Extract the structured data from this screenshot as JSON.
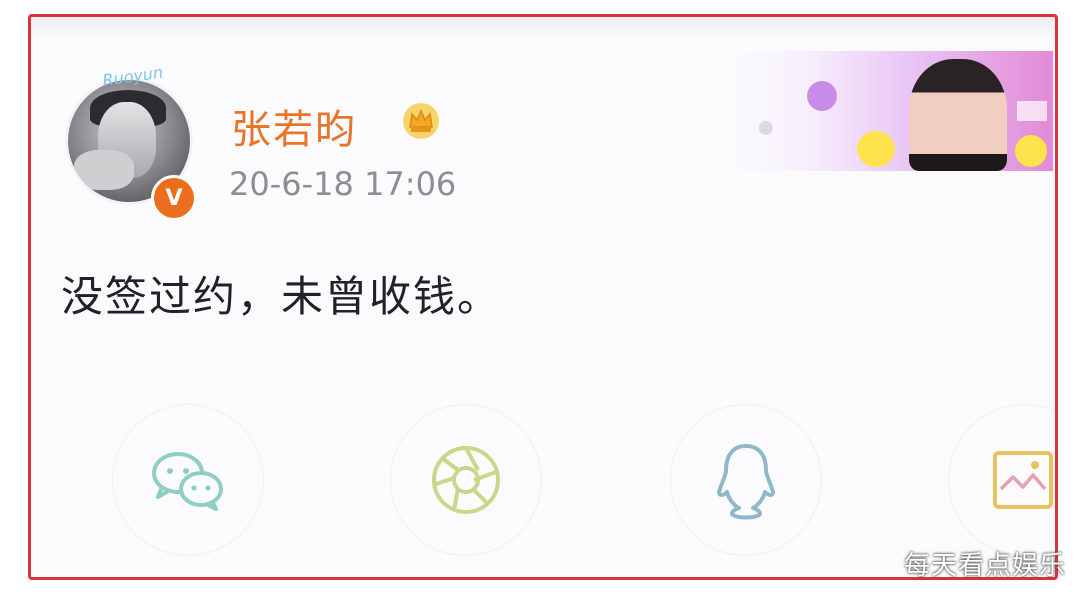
{
  "post": {
    "username": "张若昀",
    "timestamp": "20-6-18 17:06",
    "text": "没签过约，未曾收钱。",
    "verified_badge": "V",
    "avatar_decoration": "Ruoyun"
  },
  "share": {
    "buttons": [
      {
        "icon": "wechat-icon",
        "color": "#8ecfc4"
      },
      {
        "icon": "moments-shutter-icon",
        "color": "#c8d88a"
      },
      {
        "icon": "qq-penguin-icon",
        "color": "#8fb9c8"
      },
      {
        "icon": "image-icon",
        "color": "#e6c35c"
      }
    ]
  },
  "colors": {
    "frame_border": "#d9323a",
    "username": "#e8742a",
    "timestamp": "#8d8d92",
    "badge": "#ea6e1e"
  },
  "watermark": "每天看点娱乐"
}
